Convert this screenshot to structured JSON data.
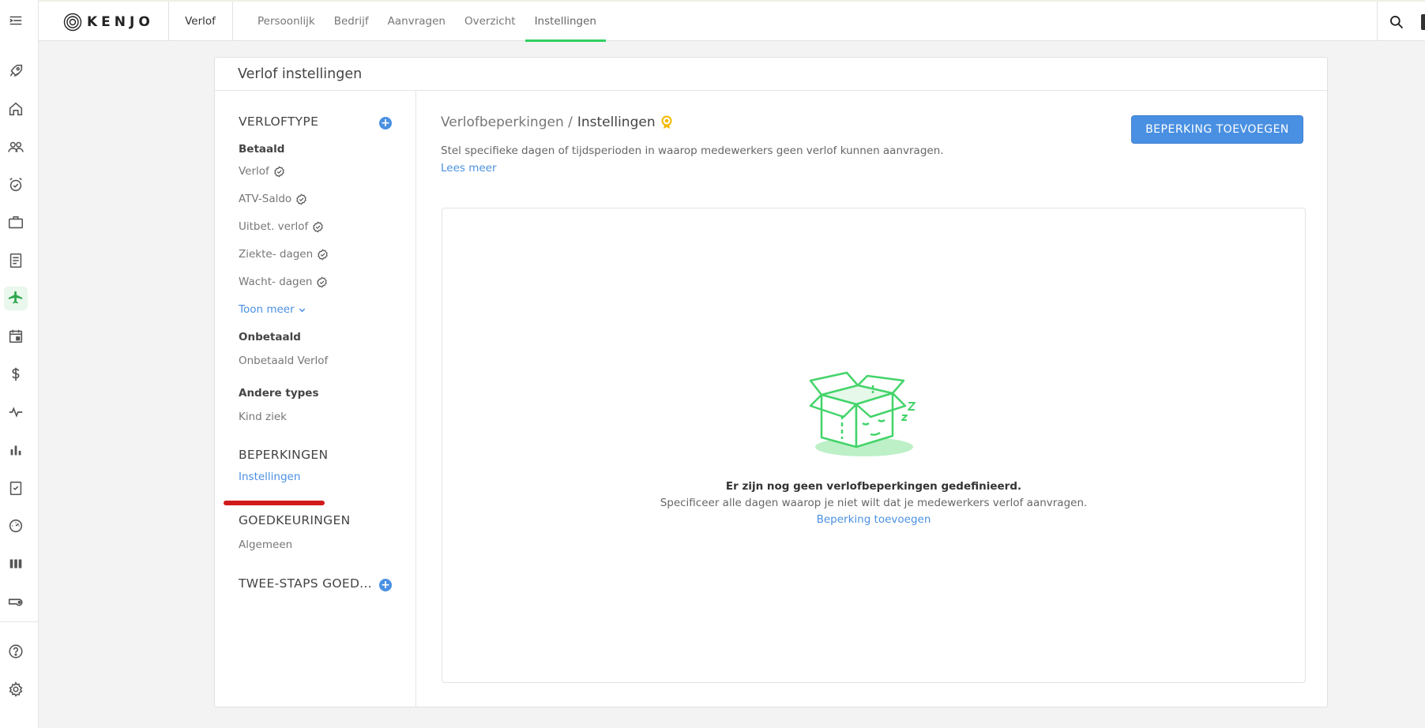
{
  "rail": {
    "items": [
      {
        "name": "rocket-icon"
      },
      {
        "name": "home-icon"
      },
      {
        "name": "people-icon"
      },
      {
        "name": "alarm-clock-icon"
      },
      {
        "name": "briefcase-icon"
      },
      {
        "name": "document-icon"
      },
      {
        "name": "airplane-icon",
        "active": true
      },
      {
        "name": "calendar-icon"
      },
      {
        "name": "dollar-icon"
      },
      {
        "name": "pulse-icon"
      },
      {
        "name": "bar-chart-icon"
      },
      {
        "name": "clipboard-check-icon"
      },
      {
        "name": "gauge-icon"
      },
      {
        "name": "columns-icon"
      },
      {
        "name": "whistle-icon"
      }
    ],
    "bottom": [
      {
        "name": "help-icon"
      },
      {
        "name": "gear-icon"
      }
    ],
    "active_color": "#2fa84f"
  },
  "topbar": {
    "logo": "KENJO",
    "module": "Verlof",
    "tabs": [
      "Persoonlijk",
      "Bedrijf",
      "Aanvragen",
      "Overzicht",
      "Instellingen"
    ],
    "active_tab": "Instellingen",
    "active_color": "#2fcf62"
  },
  "card": {
    "title": "Verlof instellingen"
  },
  "sidenav": {
    "verloftype_heading": "VERLOFTYPE",
    "betaald_label": "Betaald",
    "betaald_items": [
      "Verlof",
      "ATV-Saldo",
      "Uitbet. verlof",
      "Ziekte- dagen",
      "Wacht- dagen"
    ],
    "show_more": "Toon meer",
    "onbetaald_label": "Onbetaald",
    "onbetaald_items": [
      "Onbetaald Verlof"
    ],
    "andere_label": "Andere types",
    "andere_items": [
      "Kind ziek"
    ],
    "beperkingen_heading": "BEPERKINGEN",
    "beperkingen_link": "Instellingen",
    "goedkeuringen_heading": "GOEDKEURINGEN",
    "goedkeuringen_item": "Algemeen",
    "twee_staps_heading": "TWEE-STAPS GOED..."
  },
  "content": {
    "breadcrumb_parent": "Verlofbeperkingen /",
    "breadcrumb_current": "Instellingen",
    "description": "Stel specifieke dagen of tijdsperioden in waarop medewerkers geen verlof kunnen aanvragen.",
    "read_more": "Lees meer",
    "add_button": "BEPERKING TOEVOEGEN",
    "accent_color": "#4a90e2",
    "empty": {
      "title": "Er zijn nog geen verlofbeperkingen gedefinieerd.",
      "subtitle": "Specificeer alle dagen waarop je niet wilt dat je medewerkers verlof aanvragen.",
      "link": "Beperking toevoegen"
    }
  }
}
